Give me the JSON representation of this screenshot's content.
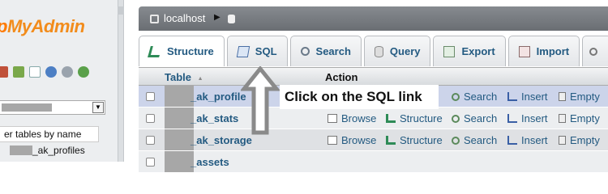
{
  "logo": {
    "php": "p",
    "my": "MyAdmin"
  },
  "nav": {
    "icons": [
      "home-icon",
      "exit-icon",
      "query-window-icon",
      "docs-icon",
      "help-icon",
      "reload-icon"
    ],
    "filter_placeholder": "er tables by name",
    "table_item": "_ak_profiles"
  },
  "server": {
    "name": "localhost"
  },
  "tabs": [
    {
      "label": "Structure",
      "icon": "structure-icon"
    },
    {
      "label": "SQL",
      "icon": "sql-icon"
    },
    {
      "label": "Search",
      "icon": "search-icon"
    },
    {
      "label": "Query",
      "icon": "query-icon"
    },
    {
      "label": "Export",
      "icon": "export-icon"
    },
    {
      "label": "Import",
      "icon": "import-icon"
    }
  ],
  "table": {
    "headers": {
      "table": "Table",
      "sort_arrow": "▲",
      "action": "Action"
    },
    "rows": [
      {
        "name": "_ak_profile"
      },
      {
        "name": "_ak_stats"
      },
      {
        "name": "_ak_storage"
      },
      {
        "name": "_assets"
      }
    ],
    "actions": {
      "browse": "Browse",
      "structure": "Structure",
      "search": "Search",
      "insert": "Insert",
      "empty": "Empty"
    }
  },
  "annotation": {
    "text": "Click on the SQL link"
  },
  "colors": {
    "link": "#235a81",
    "serverbar": "#6a6e73",
    "highlight_row": "#ccd4ea",
    "arrow": "#8a8a8a"
  }
}
